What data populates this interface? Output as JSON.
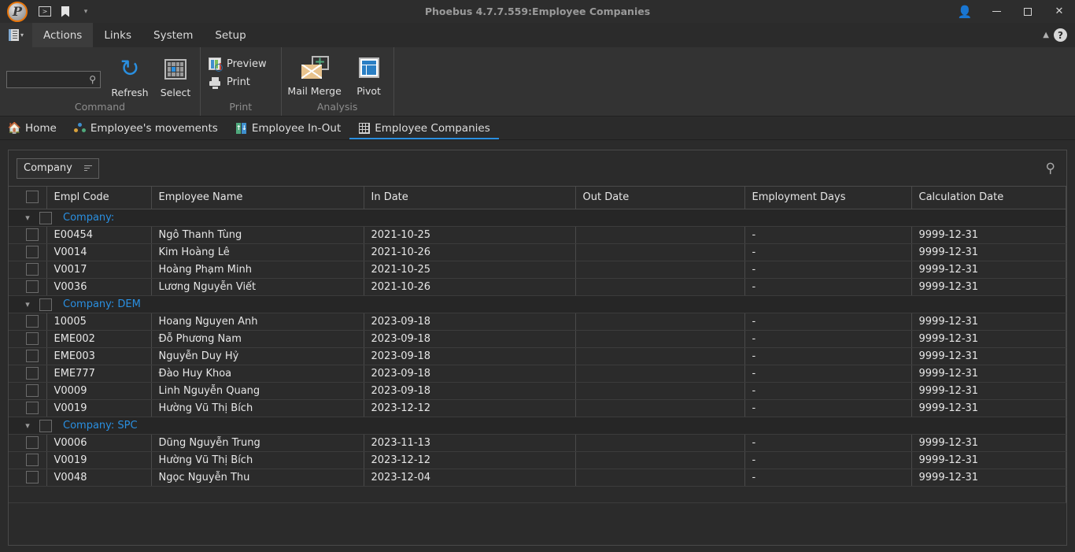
{
  "window": {
    "title": "Phoebus 4.7.7.559:Employee Companies",
    "logo_letter": "P",
    "quick_access": [
      {
        "name": "console-icon",
        "glyph": ">"
      },
      {
        "name": "bookmark-icon",
        "glyph": ""
      },
      {
        "name": "customize-caret-icon",
        "glyph": "▾"
      }
    ],
    "controls": {
      "user": "user-icon",
      "minimize": "minimize-button",
      "maximize": "maximize-button",
      "close": "✕"
    }
  },
  "menubar": {
    "file_button": "file-menu-button",
    "items": [
      {
        "label": "Actions",
        "active": true
      },
      {
        "label": "Links",
        "active": false
      },
      {
        "label": "System",
        "active": false
      },
      {
        "label": "Setup",
        "active": false
      }
    ],
    "collapse_icon": "▲",
    "help_label": "?"
  },
  "ribbon": {
    "groups": [
      {
        "label": "Command",
        "search": {
          "value": "",
          "placeholder": ""
        },
        "buttons": [
          {
            "label": "Refresh",
            "icon": "refresh-icon"
          },
          {
            "label": "Select",
            "icon": "select-grid-icon"
          }
        ]
      },
      {
        "label": "Print",
        "buttons": [
          {
            "label": "Preview",
            "icon": "preview-icon"
          },
          {
            "label": "Print",
            "icon": "printer-icon"
          }
        ]
      },
      {
        "label": "Analysis",
        "buttons": [
          {
            "label": "Mail Merge",
            "icon": "mail-merge-icon"
          },
          {
            "label": "Pivot",
            "icon": "pivot-icon"
          }
        ]
      }
    ]
  },
  "doctabs": [
    {
      "label": "Home",
      "icon": "home-icon",
      "active": false
    },
    {
      "label": "Employee's movements",
      "icon": "people-icon",
      "active": false
    },
    {
      "label": "Employee In-Out",
      "icon": "in-out-icon",
      "active": false
    },
    {
      "label": "Employee Companies",
      "icon": "grid-icon",
      "active": true
    }
  ],
  "panel": {
    "groupby_chip": "Company",
    "search_icon": "search-icon",
    "columns": [
      "Empl Code",
      "Employee Name",
      "In Date",
      "Out Date",
      "Employment Days",
      "Calculation Date"
    ],
    "groups": [
      {
        "label": "Company:",
        "rows": [
          {
            "code": "E00454",
            "name": "Ngô Thanh Tùng",
            "in_date": "2021-10-25",
            "out_date": "",
            "days": "-",
            "calc_date": "9999-12-31"
          },
          {
            "code": "V0014",
            "name": "Kim Hoàng Lê",
            "in_date": "2021-10-26",
            "out_date": "",
            "days": "-",
            "calc_date": "9999-12-31"
          },
          {
            "code": "V0017",
            "name": "Hoàng Phạm Minh",
            "in_date": "2021-10-25",
            "out_date": "",
            "days": "-",
            "calc_date": "9999-12-31"
          },
          {
            "code": "V0036",
            "name": "Lương Nguyễn Viết",
            "in_date": "2021-10-26",
            "out_date": "",
            "days": "-",
            "calc_date": "9999-12-31"
          }
        ]
      },
      {
        "label": "Company: DEM",
        "rows": [
          {
            "code": "10005",
            "name": "Hoang Nguyen Anh",
            "in_date": "2023-09-18",
            "out_date": "",
            "days": "-",
            "calc_date": "9999-12-31"
          },
          {
            "code": "EME002",
            "name": "Đỗ Phương Nam",
            "in_date": "2023-09-18",
            "out_date": "",
            "days": "-",
            "calc_date": "9999-12-31"
          },
          {
            "code": "EME003",
            "name": "Nguyễn Duy Hỷ",
            "in_date": "2023-09-18",
            "out_date": "",
            "days": "-",
            "calc_date": "9999-12-31"
          },
          {
            "code": "EME777",
            "name": "Đào Huy Khoa",
            "in_date": "2023-09-18",
            "out_date": "",
            "days": "-",
            "calc_date": "9999-12-31"
          },
          {
            "code": "V0009",
            "name": "Linh Nguyễn Quang",
            "in_date": "2023-09-18",
            "out_date": "",
            "days": "-",
            "calc_date": "9999-12-31"
          },
          {
            "code": "V0019",
            "name": "Hường Vũ Thị Bích",
            "in_date": "2023-12-12",
            "out_date": "",
            "days": "-",
            "calc_date": "9999-12-31"
          }
        ]
      },
      {
        "label": "Company: SPC",
        "rows": [
          {
            "code": "V0006",
            "name": "Dũng Nguyễn Trung",
            "in_date": "2023-11-13",
            "out_date": "",
            "days": "-",
            "calc_date": "9999-12-31"
          },
          {
            "code": "V0019",
            "name": "Hường Vũ Thị Bích",
            "in_date": "2023-12-12",
            "out_date": "",
            "days": "-",
            "calc_date": "9999-12-31"
          },
          {
            "code": "V0048",
            "name": "Ngọc Nguyễn Thu",
            "in_date": "2023-12-04",
            "out_date": "",
            "days": "-",
            "calc_date": "9999-12-31"
          }
        ]
      }
    ]
  },
  "colors": {
    "accent": "#2a8fe0",
    "window_bg": "#2b2b2b",
    "ribbon_bg": "#333333",
    "border": "#4a4a4a",
    "brand_orange": "#e8760c"
  }
}
